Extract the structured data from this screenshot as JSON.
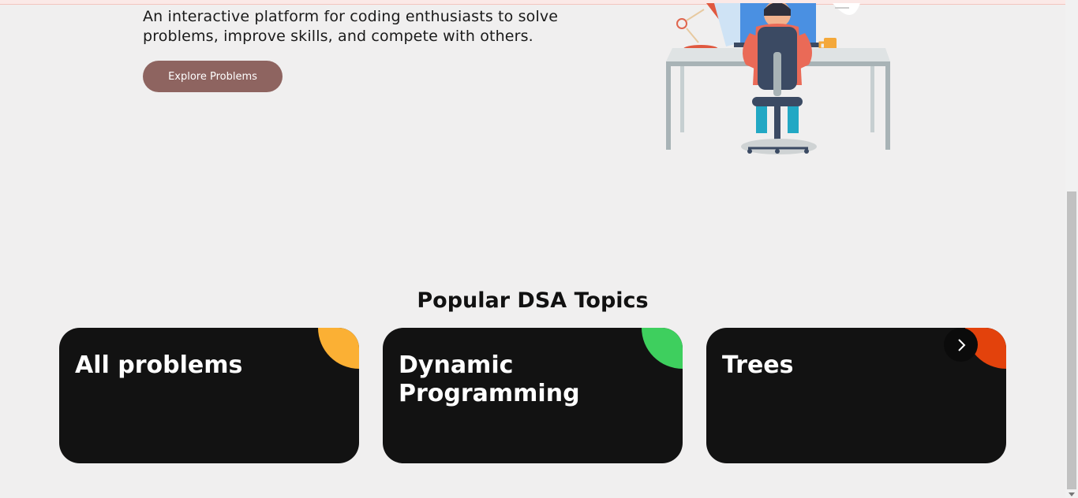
{
  "hero": {
    "tagline": "An interactive platform for coding enthusiasts to solve problems, improve skills, and compete with others.",
    "button_label": "Explore Problems",
    "illustration_icon": "developer-at-desk-illustration"
  },
  "topics": {
    "title": "Popular DSA Topics",
    "cards": [
      {
        "title": "All problems",
        "accent": "#fbb034"
      },
      {
        "title": "Dynamic Programming",
        "accent": "#3ecf5e"
      },
      {
        "title": "Trees",
        "accent": "#e3420c"
      }
    ],
    "next_icon": "chevron-right-icon"
  },
  "colors": {
    "background": "#f0efef",
    "button": "#8e6460",
    "card": "#121212"
  }
}
